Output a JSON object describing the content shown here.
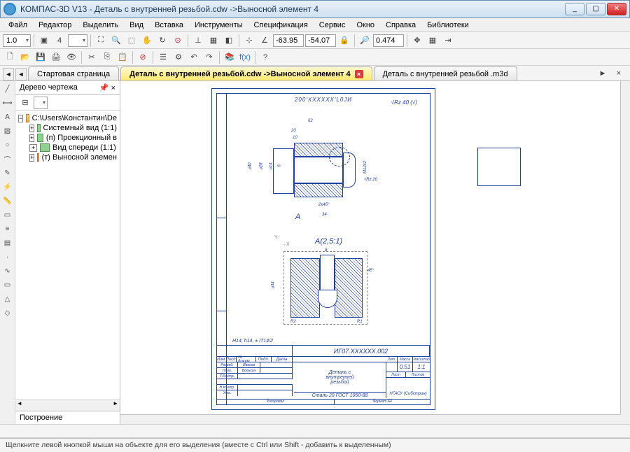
{
  "window": {
    "title": "КОМПАС-3D V13 - Деталь с внутренней резьбой.cdw ->Выносной элемент 4",
    "min": "_",
    "max": "▢",
    "close": "✕"
  },
  "menu": {
    "file": "Файл",
    "edit": "Редактор",
    "select": "Выделить",
    "view": "Вид",
    "insert": "Вставка",
    "tools": "Инструменты",
    "spec": "Спецификация",
    "service": "Сервис",
    "window": "Окно",
    "help": "Справка",
    "libs": "Библиотеки"
  },
  "toolbar2": {
    "scale": "1.0",
    "coord_x": "-63.95",
    "coord_y": "-54.07",
    "zoom": "0.474"
  },
  "tabs": {
    "t1": "Стартовая страница",
    "t2": "Деталь с внутренней резьбой.cdw ->Выносной элемент 4",
    "t3": "Деталь с внутренней резьбой .m3d"
  },
  "sidepanel": {
    "title": "Дерево чертежа",
    "bottom": "Построение",
    "root": "C:\\Users\\Константин\\De",
    "items": [
      "Системный вид (1:1)",
      "(п) Проекционный в",
      "Вид спереди (1:1)",
      "(т) Выносной элемен"
    ]
  },
  "drawing": {
    "number_top": "200'XXXXXX'L0JИ",
    "surface_main": "Rz 40 (√)",
    "surface_inner": "Rz 20",
    "dims": {
      "d62": "62",
      "d20": "20",
      "d10": "10",
      "d34": "34",
      "d2x45": "2x45°",
      "d6": "6",
      "d8": "8",
      "d45": "45°",
      "phi40": "⌀40",
      "phi28": "⌀28",
      "phi14": "⌀14",
      "M12": "M12x2",
      "phi34": "⌀34",
      "R1": "R1",
      "R2": "R2"
    },
    "letter_a": "А",
    "detail_a": "А(2,5:1)",
    "tolerance": "H14, h14, ± IT14/2",
    "tb_number": "ИГ07.XXXXXX.002",
    "tb_name": "Деталь с\nвнутренней\nрезьбой",
    "tb_material": "Сталь 20  ГОСТ 1050-88",
    "tb_org": "НГАСУ (Сибстрин)",
    "tb_lit": "Лит.",
    "tb_mass": "Масса",
    "tb_scale": "Масштаб",
    "tb_mass_v": "0,51",
    "tb_scale_v": "1:1",
    "tb_sheet": "Лист",
    "tb_sheets": "Листов",
    "tb_razrab": "Разраб.",
    "tb_prov": "Пров.",
    "tb_tkontr": "Т.Контр.",
    "tb_ncontr": "Н.Контр.",
    "tb_utv": "Утв.",
    "tb_name1": "Иванов",
    "tb_name2": "Вольхин",
    "tb_kopir": "Копировал",
    "tb_format": "Формат   А4",
    "tb_izm": "Изм.",
    "tb_list": "Лист",
    "tb_doc": "№ докум.",
    "tb_podp": "Подп.",
    "tb_data": "Дата"
  },
  "status": "Щелкните левой кнопкой мыши на объекте для его выделения (вместе с Ctrl или Shift - добавить к выделенным)"
}
